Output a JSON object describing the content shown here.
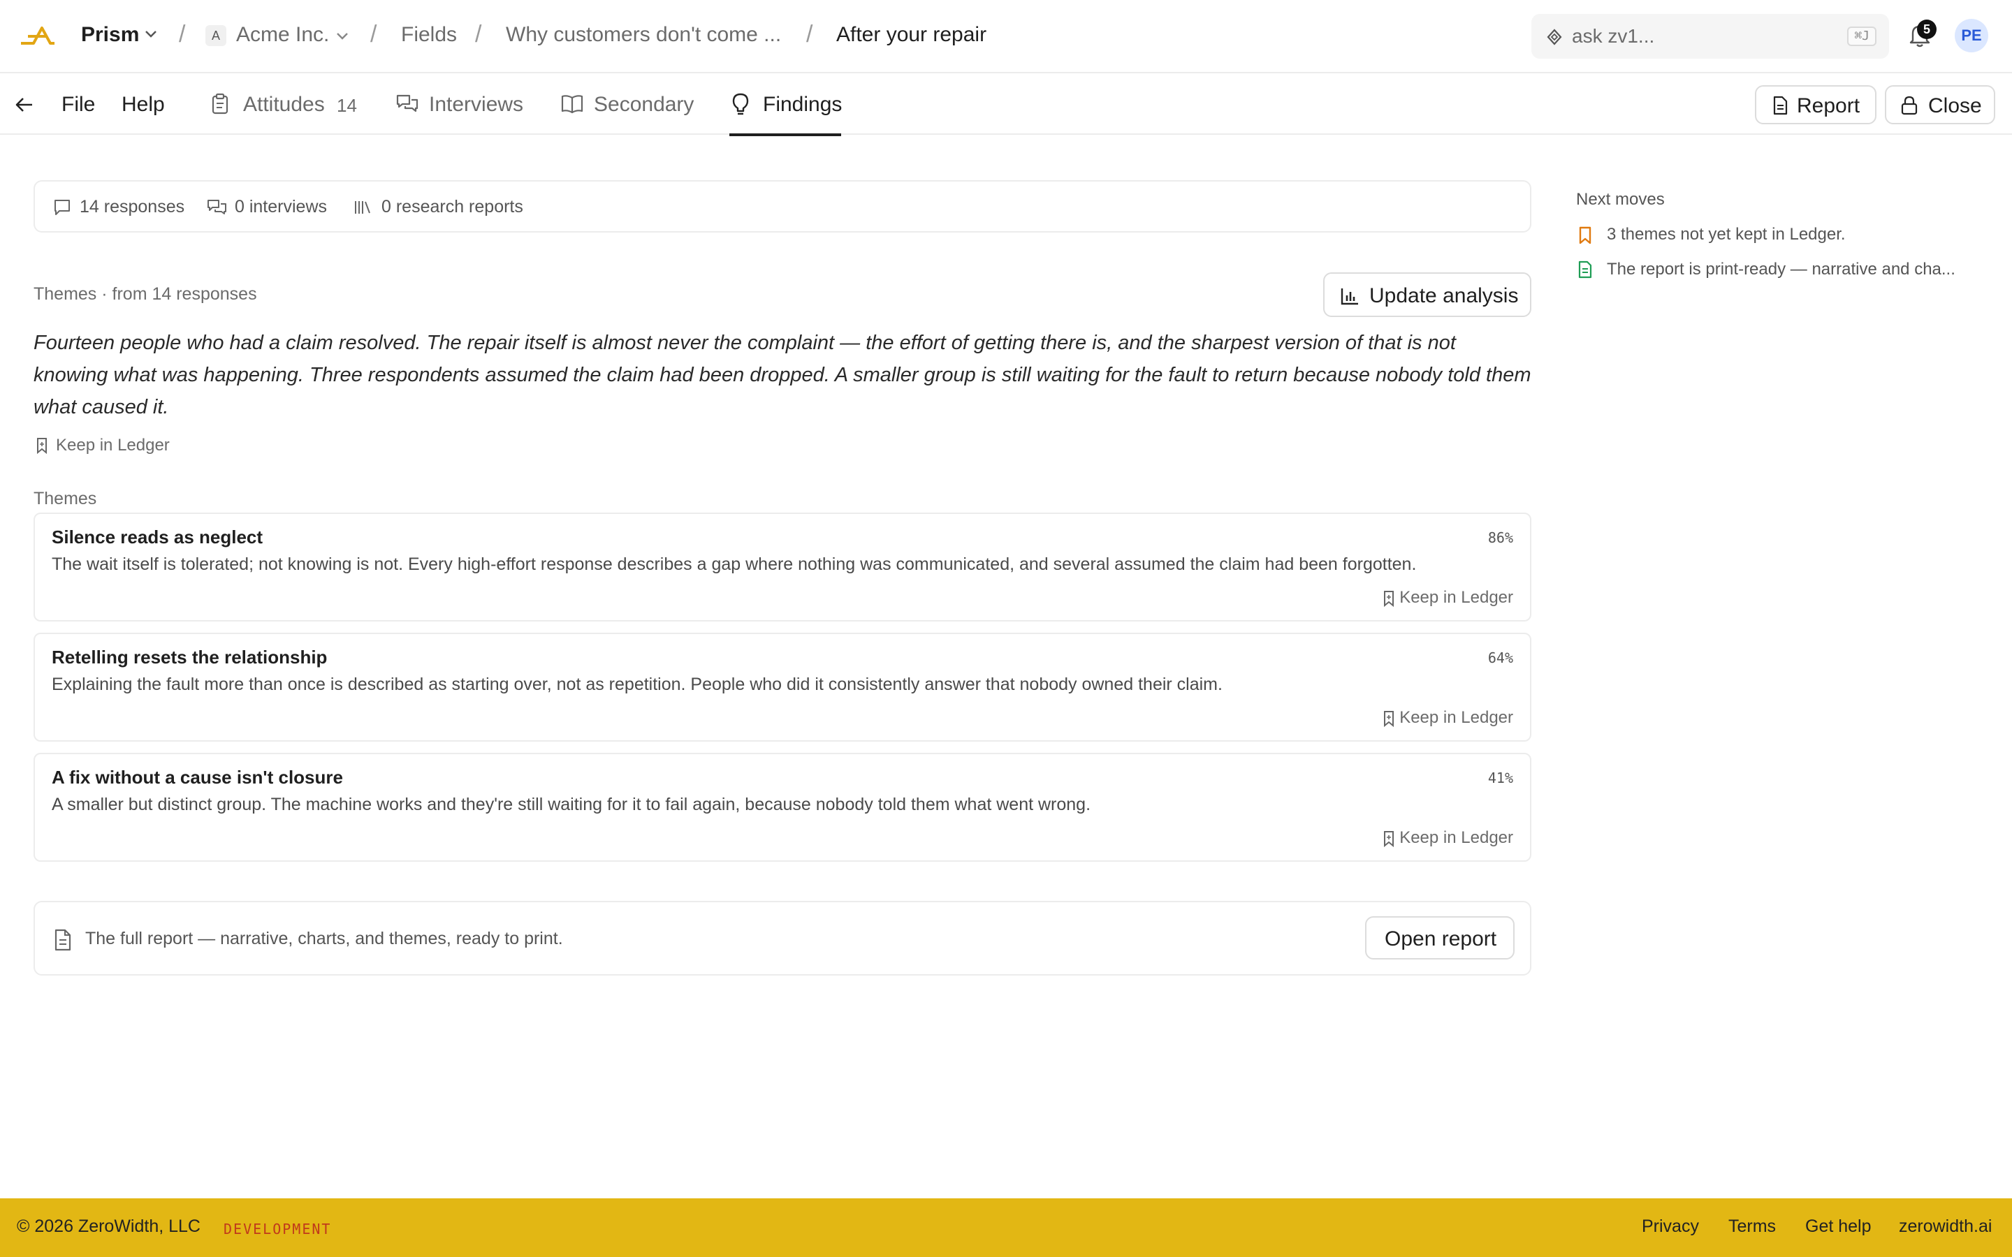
{
  "topbar": {
    "app_name": "Prism",
    "org_initial": "A",
    "org_name": "Acme Inc.",
    "breadcrumbs": [
      "Fields",
      "Why customers don't come ...",
      "After your repair"
    ],
    "search_placeholder": "ask zv1...",
    "search_shortcut": "⌘J",
    "notification_count": "5",
    "avatar_initials": "PE"
  },
  "navbar": {
    "file": "File",
    "help": "Help",
    "tabs": [
      {
        "label": "Attitudes",
        "count": "14"
      },
      {
        "label": "Interviews"
      },
      {
        "label": "Secondary"
      },
      {
        "label": "Findings"
      }
    ],
    "report_button": "Report",
    "close_button": "Close"
  },
  "stats": {
    "responses": "14 responses",
    "interviews": "0 interviews",
    "research_reports": "0 research reports"
  },
  "summary_section": {
    "header": "Themes · from 14 responses",
    "update_button": "Update analysis",
    "text": "Fourteen people who had a claim resolved. The repair itself is almost never the complaint — the effort of getting there is, and the sharpest version of that is not knowing what was happening. Three respondents assumed the claim had been dropped. A smaller group is still waiting for the fault to return because nobody told them what caused it.",
    "keep_label": "Keep in Ledger"
  },
  "themes": {
    "label": "Themes",
    "items": [
      {
        "title": "Silence reads as neglect",
        "pct": "86%",
        "desc": "The wait itself is tolerated; not knowing is not. Every high-effort response describes a gap where nothing was communicated, and several assumed the claim had been forgotten.",
        "keep": "Keep in Ledger"
      },
      {
        "title": "Retelling resets the relationship",
        "pct": "64%",
        "desc": "Explaining the fault more than once is described as starting over, not as repetition. People who did it consistently answer that nobody owned their claim.",
        "keep": "Keep in Ledger"
      },
      {
        "title": "A fix without a cause isn't closure",
        "pct": "41%",
        "desc": "A smaller but distinct group. The machine works and they're still waiting for it to fail again, because nobody told them what went wrong.",
        "keep": "Keep in Ledger"
      }
    ]
  },
  "report_box": {
    "text": "The full report — narrative, charts, and themes, ready to print.",
    "button": "Open report"
  },
  "next_moves": {
    "title": "Next moves",
    "items": [
      {
        "text": "3 themes not yet kept in Ledger.",
        "icon": "bookmark-icon",
        "color": "#e07a10"
      },
      {
        "text": "The report is print-ready — narrative and cha...",
        "icon": "document-icon",
        "color": "#1f9d55"
      }
    ]
  },
  "footer": {
    "copyright": "© 2026 ZeroWidth, LLC",
    "env": "DEVELOPMENT",
    "links": [
      "Privacy",
      "Terms",
      "Get help",
      "zerowidth.ai"
    ]
  },
  "colors": {
    "footer_bg": "#e2b714",
    "logo": "#e2a614",
    "env_text": "#c0391b",
    "avatar_bg": "#dbe7ff"
  }
}
